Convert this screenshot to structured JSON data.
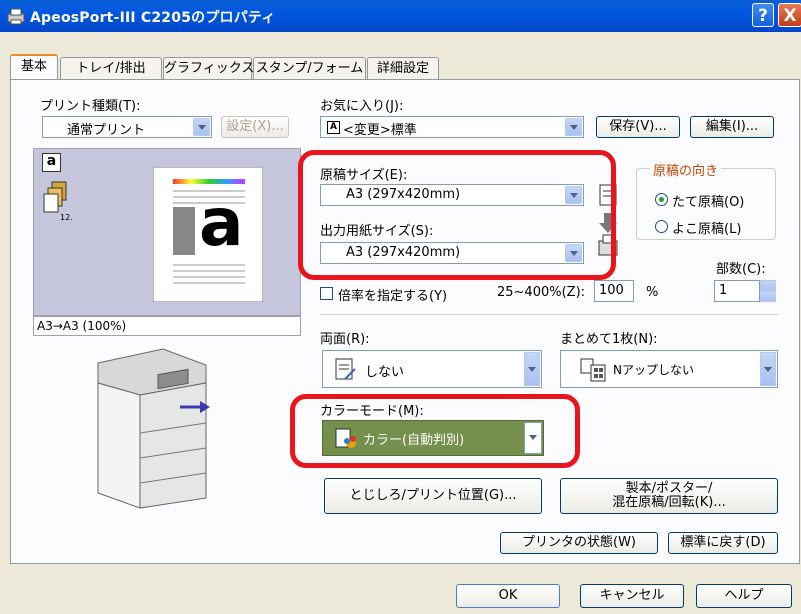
{
  "window": {
    "title": "ApeosPort-III C2205のプロパティ",
    "help_label": "?",
    "close_label": "X"
  },
  "tabs": [
    {
      "label": "基本"
    },
    {
      "label": "トレイ/排出"
    },
    {
      "label": "グラフィックス"
    },
    {
      "label": "スタンプ/フォーム"
    },
    {
      "label": "詳細設定"
    }
  ],
  "print_type": {
    "label": "プリント種類(T):",
    "value": "通常プリント",
    "settings_button": "設定(X)..."
  },
  "favorites": {
    "label": "お気に入り(J):",
    "value": "<変更>標準",
    "prefix_icon_text": "A",
    "save_button": "保存(V)...",
    "edit_button": "編集(I)..."
  },
  "original_size": {
    "label": "原稿サイズ(E):",
    "value": "A3 (297x420mm)"
  },
  "output_size": {
    "label": "出力用紙サイズ(S):",
    "value": "A3 (297x420mm)"
  },
  "orientation": {
    "group_label": "原稿の向き",
    "portrait": "たて原稿(O)",
    "landscape": "よこ原稿(L)",
    "selected": "portrait"
  },
  "scale": {
    "checkbox_label": "倍率を指定する(Y)",
    "range_label": "25~400%(Z):",
    "value": "100",
    "unit": "%"
  },
  "copies": {
    "label": "部数(C):",
    "value": "1"
  },
  "preview": {
    "status": "A3→A3 (100%)",
    "thumb_letter": "a",
    "page_letter": "a"
  },
  "duplex": {
    "label": "両面(R):",
    "value": "しない"
  },
  "nup": {
    "label": "まとめて1枚(N):",
    "value": "Nアップしない"
  },
  "color_mode": {
    "label": "カラーモード(M):",
    "value": "カラー(自動判別)"
  },
  "buttons": {
    "binding": "とじしろ/プリント位置(G)...",
    "booklet_line1": "製本/ポスター/",
    "booklet_line2": "混在原稿/回転(K)...",
    "printer_status": "プリンタの状態(W)",
    "restore_default": "標準に戻す(D)"
  },
  "footer": {
    "ok": "OK",
    "cancel": "キャンセル",
    "help": "ヘルプ"
  },
  "colors": {
    "highlight_red": "#e8161c",
    "title_blue": "#0058e0",
    "color_mode_bg": "#758f4d"
  }
}
